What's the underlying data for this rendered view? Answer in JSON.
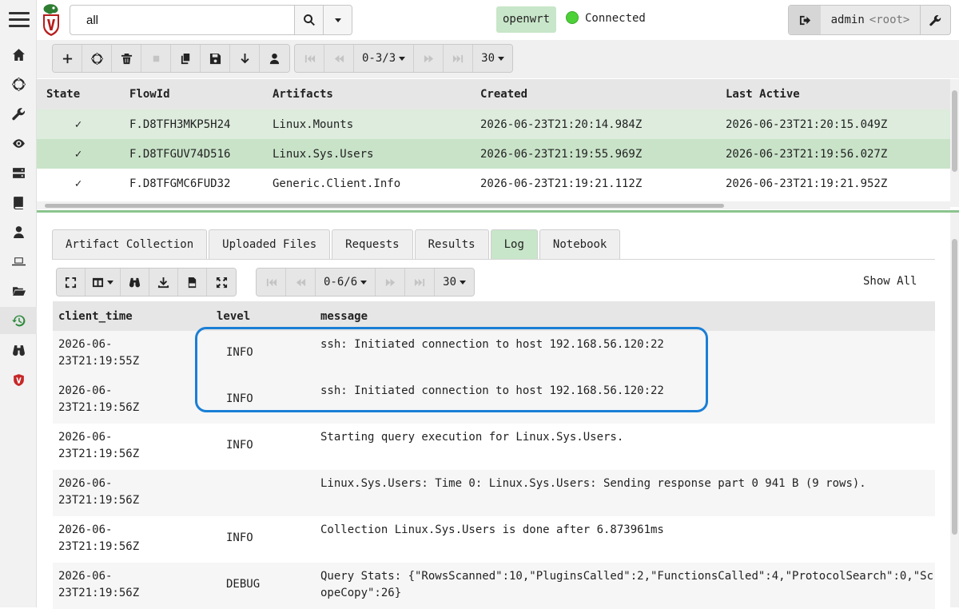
{
  "search": {
    "value": "all"
  },
  "host": {
    "name": "openwrt",
    "status": "Connected",
    "status_color": "#4cd137"
  },
  "user": {
    "name": "admin",
    "role": "<root>"
  },
  "flows_pager": {
    "range": "0-3/3",
    "page_size": "30"
  },
  "flows_table": {
    "headers": [
      "State",
      "FlowId",
      "Artifacts",
      "Created",
      "Last Active"
    ],
    "rows": [
      {
        "state": "✓",
        "flow_id": "F.D8TFH3MKP5H24",
        "artifact": "Linux.Mounts",
        "created": "2026-06-23T21:20:14.984Z",
        "last_active": "2026-06-23T21:20:15.049Z"
      },
      {
        "state": "✓",
        "flow_id": "F.D8TFGUV74D516",
        "artifact": "Linux.Sys.Users",
        "created": "2026-06-23T21:19:55.969Z",
        "last_active": "2026-06-23T21:19:56.027Z"
      },
      {
        "state": "✓",
        "flow_id": "F.D8TFGMC6FUD32",
        "artifact": "Generic.Client.Info",
        "created": "2026-06-23T21:19:21.112Z",
        "last_active": "2026-06-23T21:19:21.952Z"
      }
    ]
  },
  "tabs": [
    "Artifact Collection",
    "Uploaded Files",
    "Requests",
    "Results",
    "Log",
    "Notebook"
  ],
  "log_pager": {
    "range": "0-6/6",
    "page_size": "30",
    "show_all": "Show All"
  },
  "log_table": {
    "headers": [
      "client_time",
      "level",
      "message"
    ],
    "rows": [
      {
        "time": "2026-06-\n23T21:19:55Z",
        "level": "INFO",
        "message": "ssh: Initiated connection to host 192.168.56.120:22"
      },
      {
        "time": "2026-06-\n23T21:19:56Z",
        "level": "INFO",
        "message": "ssh: Initiated connection to host 192.168.56.120:22"
      },
      {
        "time": "2026-06-\n23T21:19:56Z",
        "level": "INFO",
        "message": "Starting query execution for Linux.Sys.Users."
      },
      {
        "time": "2026-06-\n23T21:19:56Z",
        "level": "",
        "message": "Linux.Sys.Users: Time 0: Linux.Sys.Users: Sending response part 0 941 B (9 rows)."
      },
      {
        "time": "2026-06-\n23T21:19:56Z",
        "level": "INFO",
        "message": "Collection Linux.Sys.Users is done after 6.873961ms"
      },
      {
        "time": "2026-06-\n23T21:19:56Z",
        "level": "DEBUG",
        "message": "Query Stats: {\"RowsScanned\":10,\"PluginsCalled\":2,\"FunctionsCalled\":4,\"ProtocolSearch\":0,\"ScopeCopy\":26}"
      }
    ]
  },
  "colors": {
    "accent_green": "#c8e6c9",
    "selected_row": "#c9e3c9",
    "highlight_blue": "#1a7fd6"
  }
}
